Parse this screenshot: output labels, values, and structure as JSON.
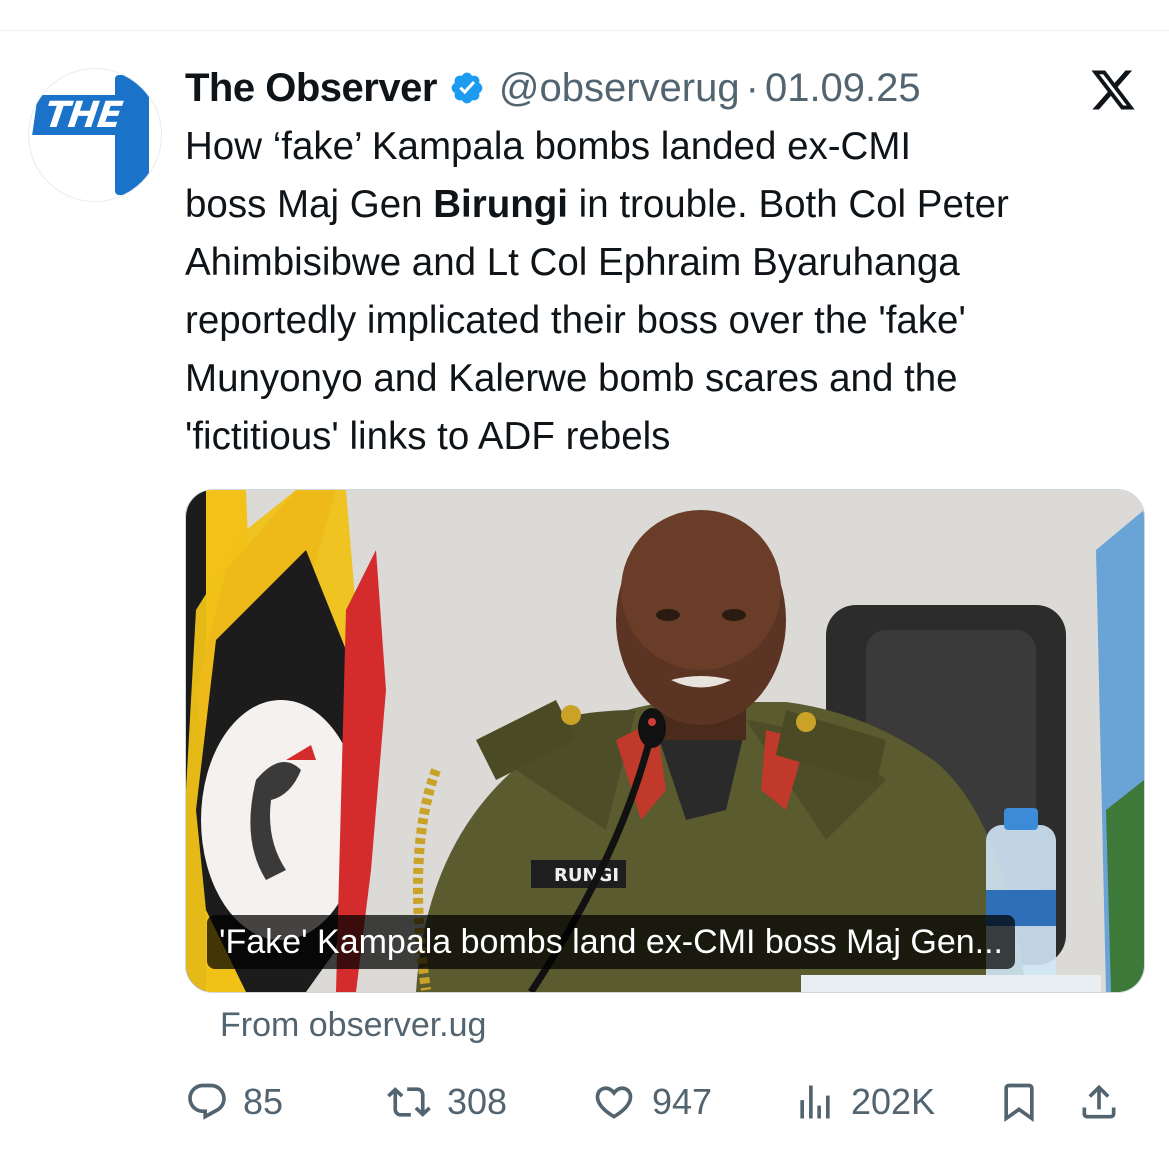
{
  "account": {
    "display_name": "The Observer",
    "handle": "@observerug",
    "separator": "·",
    "date": "01.09.25",
    "avatar_text": "THE",
    "verified": true,
    "verified_color": "#1d9bf0"
  },
  "tweet": {
    "text_before_bold": "How ‘fake’ Kampala bombs landed ex-CMI\nboss Maj Gen ",
    "bold_text": "Birungi",
    "text_after_bold": " in trouble. Both Col Peter\nAhimbisibwe and Lt Col Ephraim Byaruhanga\nreportedly implicated their boss over the 'fake'\nMunyonyo and Kalerwe bomb scares and the\n'fictitious' links to ADF rebels"
  },
  "media": {
    "caption": "'Fake' Kampala bombs land ex-CMI boss Maj Gen...",
    "name_tag_text": "RUNGI",
    "source": "From observer.ug"
  },
  "actions": {
    "replies": "85",
    "reposts": "308",
    "likes": "947",
    "views": "202K"
  },
  "icons": {
    "platform_logo": "x-logo-icon",
    "reply": "reply-icon",
    "repost": "repost-icon",
    "like": "heart-icon",
    "views": "views-icon",
    "bookmark": "bookmark-icon",
    "share": "share-icon"
  },
  "colors": {
    "text_primary": "#0f1419",
    "text_secondary": "#536471",
    "brand_blue": "#1a73c9"
  }
}
